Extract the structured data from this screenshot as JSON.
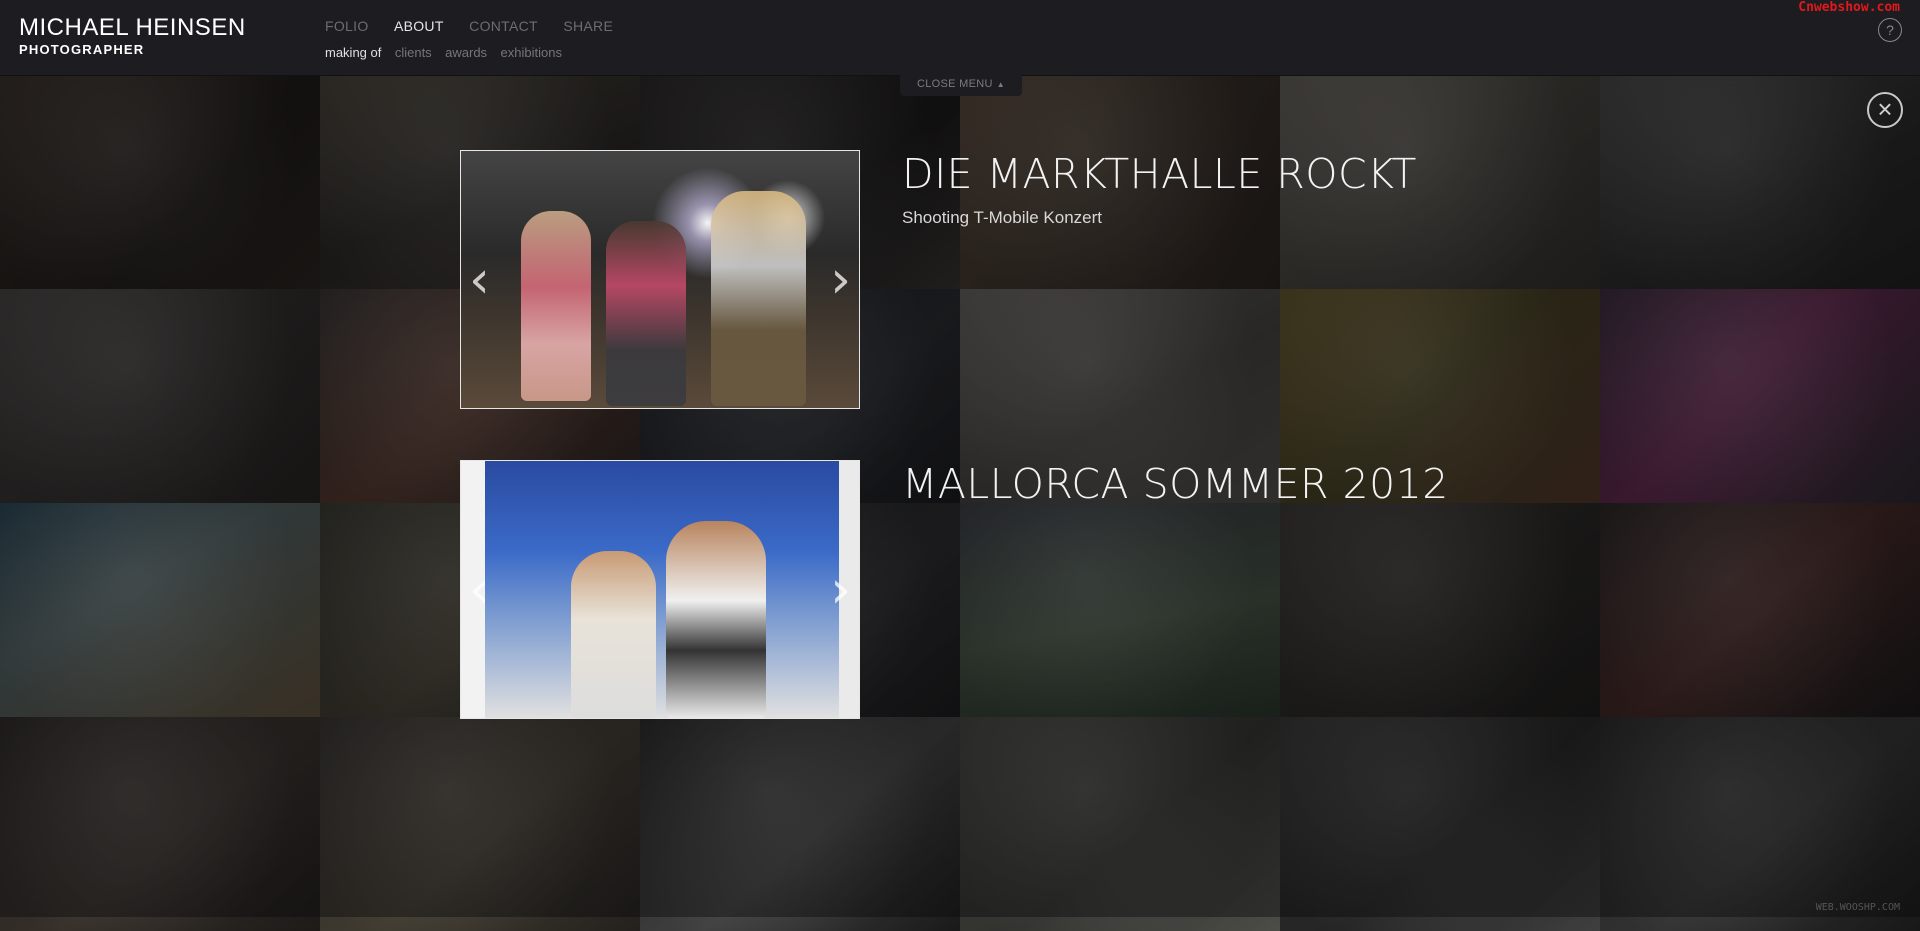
{
  "brand": {
    "name": "MICHAEL HEINSEN",
    "role": "PHOTOGRAPHER"
  },
  "nav": {
    "main": [
      {
        "label": "FOLIO",
        "active": false
      },
      {
        "label": "ABOUT",
        "active": true
      },
      {
        "label": "CONTACT",
        "active": false
      },
      {
        "label": "SHARE",
        "active": false
      }
    ],
    "sub": [
      {
        "label": "making of",
        "active": true
      },
      {
        "label": "clients",
        "active": false
      },
      {
        "label": "awards",
        "active": false
      },
      {
        "label": "exhibitions",
        "active": false
      }
    ]
  },
  "watermark": "Cnwebshow.com",
  "help_label": "?",
  "close_menu_label": "CLOSE MENU",
  "close_symbol": "×",
  "entries": [
    {
      "title": "DIE MARKTHALLE ROCKT",
      "subtitle": "Shooting T-Mobile Konzert"
    },
    {
      "title": "MALLORCA SOMMER 2012",
      "subtitle": ""
    }
  ],
  "arrows": {
    "prev": "‹",
    "next": "›"
  },
  "footer_mark": "WEB.WOOSHP.COM",
  "colors": {
    "header_bg": "#1d1c20",
    "watermark": "#e0191c",
    "active_nav": "#e6e6e6",
    "inactive_nav": "#6e6c72"
  },
  "icons": [
    "help-icon",
    "close-icon",
    "caret-up-icon",
    "chevron-left-icon",
    "chevron-right-icon"
  ]
}
